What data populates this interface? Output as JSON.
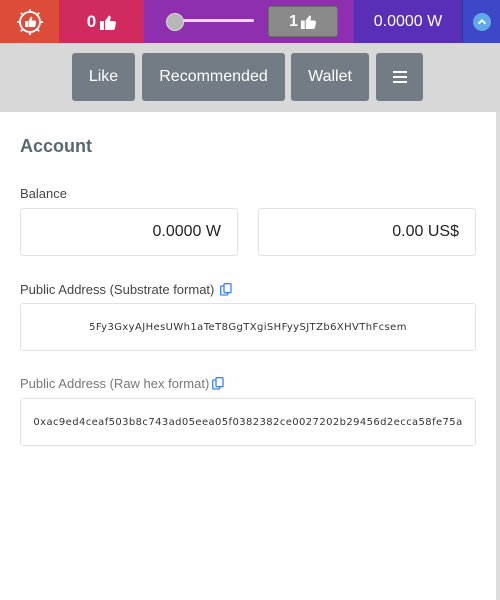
{
  "topbar": {
    "logo_icon": "gear-thumbs-up-icon",
    "likes_count": "0",
    "slider": {
      "value_fraction": 0.0
    },
    "per_like_count": "1",
    "wallet_balance": "0.0000 W",
    "collapse_icon": "chevron-up-icon",
    "colors": {
      "logo_bg": "#dd4b39",
      "likes_bg": "#d02a5f",
      "slider_bg": "#8e2fb0",
      "wallet_bg": "#5a2fb8",
      "collapse_bg": "#3e47c8"
    }
  },
  "nav": {
    "like_label": "Like",
    "recommended_label": "Recommended",
    "wallet_label": "Wallet",
    "menu_icon": "hamburger-menu-icon"
  },
  "account": {
    "title": "Account",
    "balance_label": "Balance",
    "balance_w": "0.0000 W",
    "balance_usd": "0.00 US$",
    "substrate_label": "Public Address (Substrate format)",
    "substrate_address": "5Fy3GxyAJHesUWh1aTeT8GgTXgiSHFyySJTZb6XHVThFcsem",
    "hex_label": "Public Address (Raw hex format)",
    "hex_address": "0xac9ed4ceaf503b8c743ad05eea05f0382382ce0027202b29456d2ecca58fe75a",
    "copy_icon": "copy-icon"
  }
}
